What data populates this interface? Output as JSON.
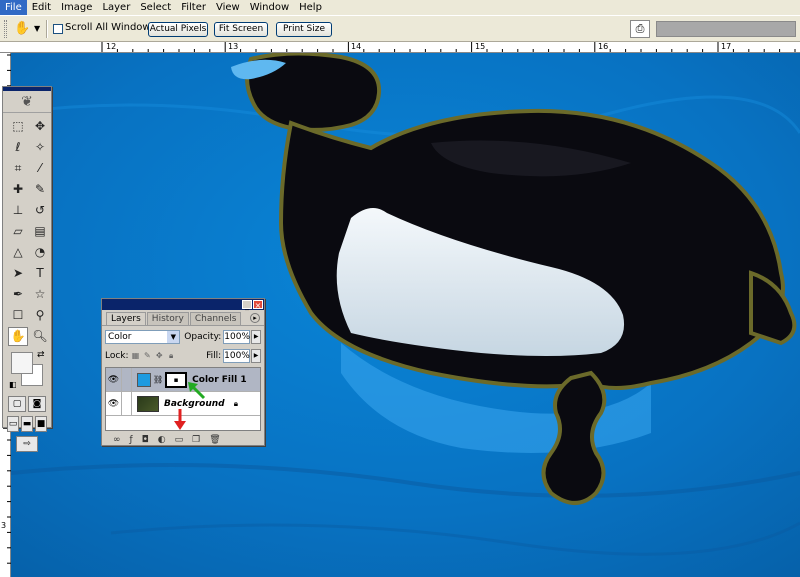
{
  "menu": [
    "File",
    "Edit",
    "Image",
    "Layer",
    "Select",
    "Filter",
    "View",
    "Window",
    "Help"
  ],
  "options_bar": {
    "scroll_all_label": "Scroll All Windows",
    "actual_pixels": "Actual Pixels",
    "fit_screen": "Fit Screen",
    "print_size": "Print Size"
  },
  "ruler": {
    "top": [
      "12",
      "13",
      "14",
      "15",
      "16",
      "17"
    ],
    "left": [
      "3"
    ]
  },
  "layers_panel": {
    "tabs": [
      "Layers",
      "History",
      "Channels"
    ],
    "blend_mode": "Color",
    "opacity_label": "Opacity:",
    "opacity_value": "100%",
    "lock_label": "Lock:",
    "fill_label": "Fill:",
    "fill_value": "100%",
    "layers": [
      {
        "name": "Color Fill 1",
        "selected": true,
        "thumb_color": "#1e9be0"
      },
      {
        "name": "Background",
        "selected": false
      }
    ]
  },
  "colors": {
    "water": "#0a78c8",
    "duck_black": "#0a0a10",
    "duck_white": "#e8f2f8",
    "annotation_red": "#e02020",
    "annotation_green": "#22aa22"
  }
}
